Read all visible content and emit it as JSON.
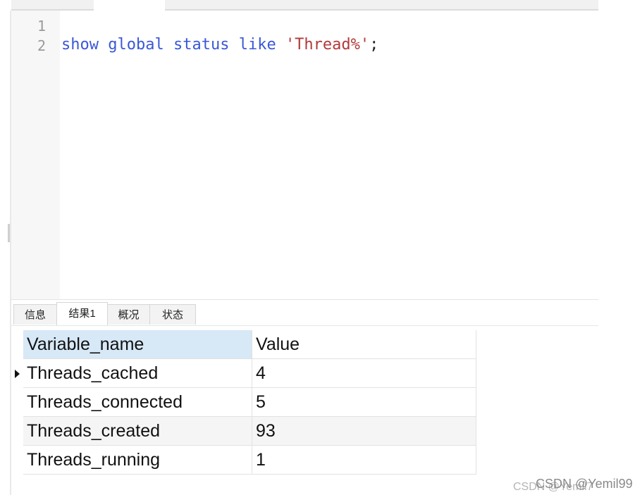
{
  "editor": {
    "line_numbers": [
      "1",
      "2"
    ],
    "tokens": {
      "show": "show",
      "global": "global",
      "status": "status",
      "like": "like",
      "pattern": "'Thread%'",
      "terminator": ";"
    }
  },
  "tabs": [
    {
      "label": "信息",
      "active": false
    },
    {
      "label": "结果1",
      "active": true
    },
    {
      "label": "概况",
      "active": false
    },
    {
      "label": "状态",
      "active": false
    }
  ],
  "grid": {
    "columns": [
      "Variable_name",
      "Value"
    ],
    "rows": [
      {
        "name": "Threads_cached",
        "value": "4",
        "current": true
      },
      {
        "name": "Threads_connected",
        "value": "5"
      },
      {
        "name": "Threads_created",
        "value": "93"
      },
      {
        "name": "Threads_running",
        "value": "1"
      }
    ]
  },
  "watermark": {
    "back": "CSDN @Yemil7",
    "front": "CSDN @Yemil99"
  },
  "colors": {
    "keyword": "#3a58d6",
    "string": "#b13a3a",
    "header_selected": "#d7e8f7"
  }
}
